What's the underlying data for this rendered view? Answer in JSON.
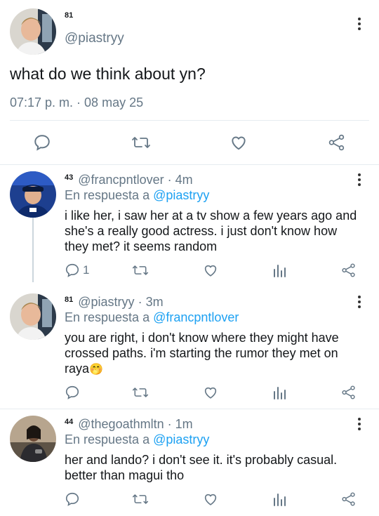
{
  "main_tweet": {
    "badge": "81",
    "handle": "@piastryy",
    "text": "what do we think about yn?",
    "timestamp": "07:17 p. m. · 08 may 25"
  },
  "replies": [
    {
      "badge": "43",
      "handle": "@francpntlover",
      "time": "4m",
      "reply_prefix": "En respuesta a",
      "reply_to": "@piastryy",
      "text_lines": [
        "i like her, i saw her at a tv show a few years ago and",
        "she's a really good actress. i just don't know how",
        "they met? it seems random"
      ],
      "reply_count": "1"
    },
    {
      "badge": "81",
      "handle": "@piastryy",
      "time": "3m",
      "reply_prefix": "En respuesta a",
      "reply_to": "@francpntlover",
      "text_lines": [
        "you are right, i don't know where they might have",
        "crossed paths. i'm starting the rumor they met on",
        "raya"
      ],
      "reply_count": ""
    },
    {
      "badge": "44",
      "handle": "@thegoathmltn",
      "time": "1m",
      "reply_prefix": "En respuesta a",
      "reply_to": "@piastryy",
      "text_lines": [
        "her and lando? i don't see it. it's probably casual.",
        "better than magui tho"
      ],
      "reply_count": ""
    }
  ],
  "separator": "·",
  "emoji": "🤭",
  "colors": {
    "link": "#1da1f2",
    "muted": "#657786",
    "text": "#14171a",
    "divider": "#e6ecf0"
  },
  "icons": [
    "kebab-menu-icon",
    "reply-icon",
    "retweet-icon",
    "heart-icon",
    "analytics-icon",
    "share-icon"
  ]
}
